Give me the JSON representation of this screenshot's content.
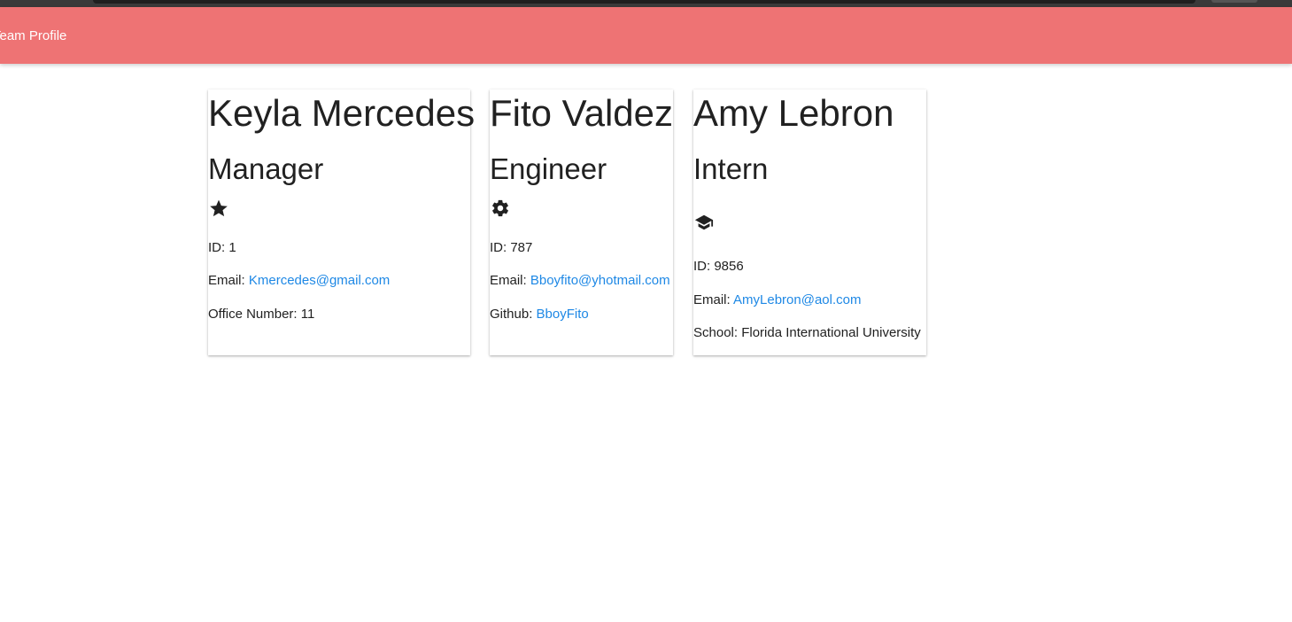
{
  "header": {
    "title": "Team Profile"
  },
  "colors": {
    "navbar": "#ee7374",
    "link": "#1e88e5"
  },
  "employees": [
    {
      "name": "Keyla Mercedes",
      "role": "Manager",
      "icon": "star-icon",
      "id_label": "ID:",
      "id": "1",
      "email_label": "Email:",
      "email": "Kmercedes@gmail.com",
      "extra_label": "Office Number:",
      "extra": "11"
    },
    {
      "name": "Fito Valdez",
      "role": "Engineer",
      "icon": "gear-icon",
      "id_label": "ID:",
      "id": "787",
      "email_label": "Email:",
      "email": "Bboyfito@yhotmail.com",
      "extra_label": "Github:",
      "extra": "BboyFito"
    },
    {
      "name": "Amy Lebron",
      "role": "Intern",
      "icon": "graduation-cap-icon",
      "id_label": "ID:",
      "id": "9856",
      "email_label": "Email:",
      "email": "AmyLebron@aol.com",
      "extra_label": "School:",
      "extra": "Florida International University"
    }
  ]
}
